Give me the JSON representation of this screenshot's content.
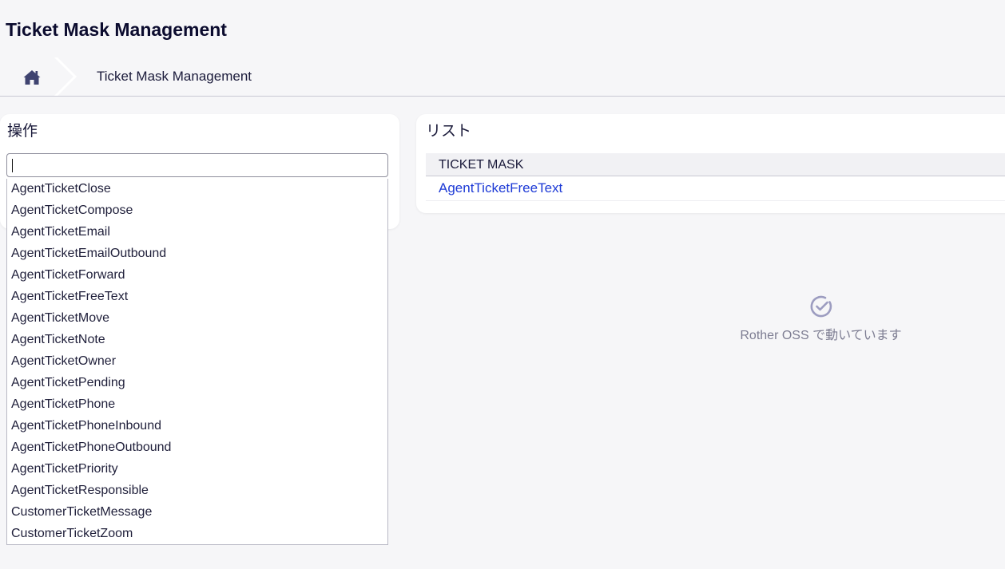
{
  "header": {
    "title": "Ticket Mask Management"
  },
  "breadcrumb": {
    "home_icon": "home-icon",
    "current": "Ticket Mask Management"
  },
  "actions_panel": {
    "title": "操作",
    "search": {
      "value": "",
      "placeholder": ""
    },
    "options": [
      "AgentTicketClose",
      "AgentTicketCompose",
      "AgentTicketEmail",
      "AgentTicketEmailOutbound",
      "AgentTicketForward",
      "AgentTicketFreeText",
      "AgentTicketMove",
      "AgentTicketNote",
      "AgentTicketOwner",
      "AgentTicketPending",
      "AgentTicketPhone",
      "AgentTicketPhoneInbound",
      "AgentTicketPhoneOutbound",
      "AgentTicketPriority",
      "AgentTicketResponsible",
      "CustomerTicketMessage",
      "CustomerTicketZoom"
    ]
  },
  "list_panel": {
    "title": "リスト",
    "column_header": "TICKET MASK",
    "rows": [
      "AgentTicketFreeText"
    ]
  },
  "footer": {
    "powered_by": "Rother OSS で動いています",
    "icon": "check-circle-icon"
  },
  "colors": {
    "link": "#1d3ad6",
    "title": "#0b0b2e",
    "background": "#f6f6f8"
  }
}
